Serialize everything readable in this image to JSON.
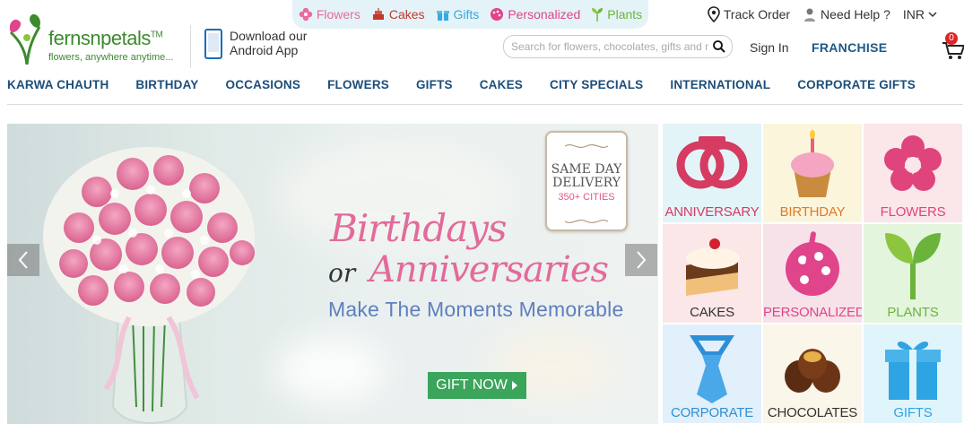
{
  "header": {
    "categories": [
      {
        "label": "Flowers",
        "icon": "flower-icon",
        "color": "#e86aa0"
      },
      {
        "label": "Cakes",
        "icon": "cake-icon",
        "color": "#c0392b"
      },
      {
        "label": "Gifts",
        "icon": "gift-icon",
        "color": "#3aa8e0"
      },
      {
        "label": "Personalized",
        "icon": "palette-icon",
        "color": "#e0448b"
      },
      {
        "label": "Plants",
        "icon": "plant-icon",
        "color": "#6bb43c"
      }
    ],
    "logo": {
      "name": "fernsnpetals",
      "tm": "TM",
      "tagline": "flowers, anywhere anytime..."
    },
    "app_promo": {
      "line1": "Download our",
      "line2": "Android App"
    },
    "track_order": "Track Order",
    "need_help": "Need Help ?",
    "currency": "INR",
    "search": {
      "placeholder": "Search for flowers, chocolates, gifts and more"
    },
    "sign_in": "Sign In",
    "franchise": "FRANCHISE",
    "cart_count": "0"
  },
  "nav": [
    "KARWA CHAUTH",
    "BIRTHDAY",
    "OCCASIONS",
    "FLOWERS",
    "GIFTS",
    "CAKES",
    "CITY SPECIALS",
    "INTERNATIONAL",
    "CORPORATE GIFTS"
  ],
  "banner": {
    "badge_line1": "SAME DAY",
    "badge_line2": "DELIVERY",
    "badge_line3": "350+ CITIES",
    "headline1": "Birthdays",
    "headline_or": "or",
    "headline2": "Anniversaries",
    "subline": "Make The Moments Memorable",
    "cta": "GIFT NOW"
  },
  "tiles": [
    {
      "label": "ANNIVERSARY",
      "icon": "rings-icon",
      "bg": "#e2f4f8",
      "color": "#d63b62"
    },
    {
      "label": "BIRTHDAY",
      "icon": "cupcake-icon",
      "bg": "#fbf5dc",
      "color": "#e07a26"
    },
    {
      "label": "FLOWERS",
      "icon": "flower-icon",
      "bg": "#fbe6e9",
      "color": "#e0447c"
    },
    {
      "label": "CAKES",
      "icon": "cake-slice-icon",
      "bg": "#fbe7e7",
      "color": "#333333"
    },
    {
      "label": "PERSONALIZED",
      "icon": "palette-icon",
      "bg": "#f8e2ea",
      "color": "#e0448b"
    },
    {
      "label": "PLANTS",
      "icon": "plant-icon",
      "bg": "#e4f5dd",
      "color": "#6bb43c"
    },
    {
      "label": "CORPORATE",
      "icon": "tie-icon",
      "bg": "#e2f0fb",
      "color": "#2e8fd6"
    },
    {
      "label": "CHOCOLATES",
      "icon": "chocolates-icon",
      "bg": "#fbf6ea",
      "color": "#333333"
    },
    {
      "label": "GIFTS",
      "icon": "gift-box-icon",
      "bg": "#e0f4fb",
      "color": "#2fa4e2"
    }
  ]
}
